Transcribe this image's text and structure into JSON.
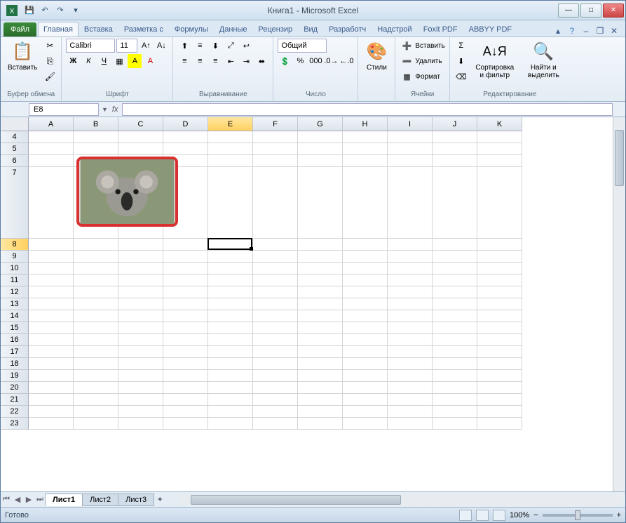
{
  "title": "Книга1 - Microsoft Excel",
  "tabs": {
    "file": "Файл",
    "list": [
      "Главная",
      "Вставка",
      "Разметка с",
      "Формулы",
      "Данные",
      "Рецензир",
      "Вид",
      "Разработч",
      "Надстрой",
      "Foxit PDF",
      "ABBYY PDF"
    ],
    "active_index": 0
  },
  "ribbon": {
    "clipboard": {
      "label": "Буфер обмена",
      "paste": "Вставить"
    },
    "font": {
      "label": "Шрифт",
      "name": "Calibri",
      "size": "11"
    },
    "align": {
      "label": "Выравнивание"
    },
    "number": {
      "label": "Число",
      "format": "Общий"
    },
    "styles": {
      "label": "Стили",
      "btn": "Стили"
    },
    "cells": {
      "label": "Ячейки",
      "insert": "Вставить",
      "delete": "Удалить",
      "format": "Формат"
    },
    "editing": {
      "label": "Редактирование",
      "sort": "Сортировка и фильтр",
      "find": "Найти и выделить"
    }
  },
  "name_box": "E8",
  "fx": "fx",
  "columns": [
    "A",
    "B",
    "C",
    "D",
    "E",
    "F",
    "G",
    "H",
    "I",
    "J",
    "K"
  ],
  "rows": [
    4,
    5,
    6,
    7,
    8,
    9,
    10,
    11,
    12,
    13,
    14,
    15,
    16,
    17,
    18,
    19,
    20,
    21,
    22,
    23
  ],
  "tall_row": 7,
  "selected_row": 8,
  "selected_col": "E",
  "sheets": {
    "list": [
      "Лист1",
      "Лист2",
      "Лист3"
    ],
    "active": 0
  },
  "status": {
    "ready": "Готово",
    "zoom": "100%"
  },
  "embedded_image": {
    "alt": "koala-photo"
  }
}
